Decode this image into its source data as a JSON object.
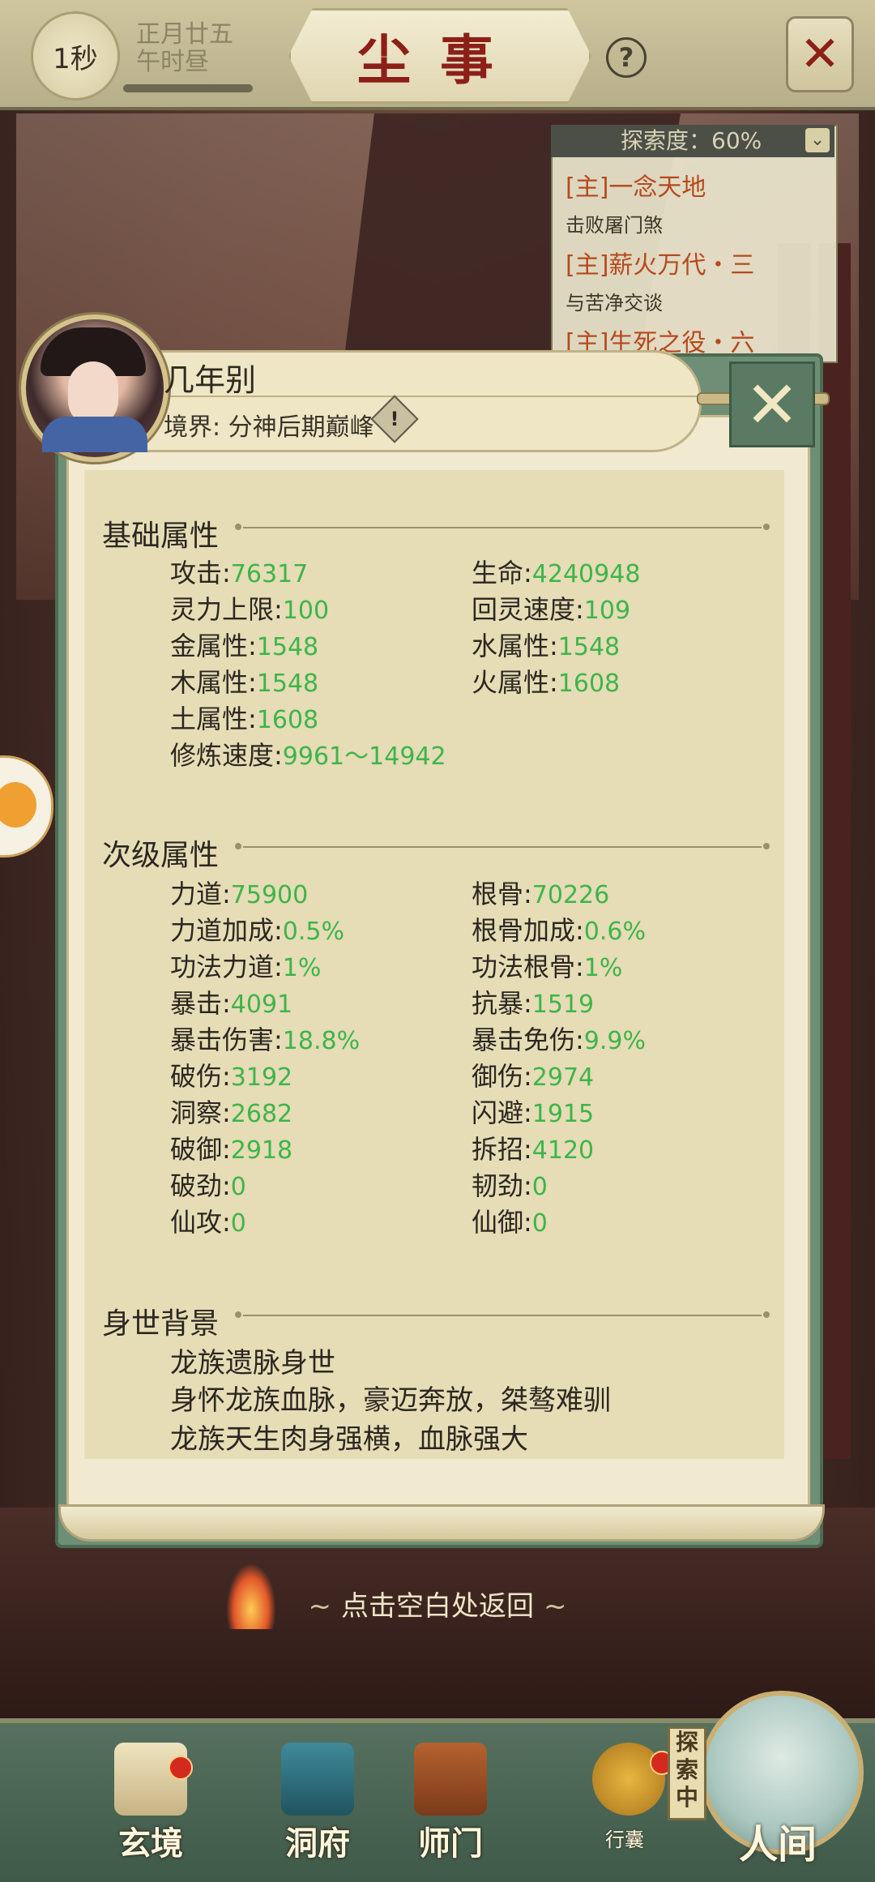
{
  "header": {
    "timer": "1秒",
    "date_line1": "正月廿五",
    "date_line2": "午时昼",
    "title": "尘事"
  },
  "quest_panel": {
    "explore_label": "探索度：60%",
    "quests": [
      {
        "title": "[主]一念天地",
        "desc": "击败屠门煞"
      },
      {
        "title": "[主]薪火万代・三",
        "desc": "与苦净交谈"
      },
      {
        "title": "[主]生死之役・六",
        "desc": ""
      }
    ]
  },
  "character": {
    "name": "几年别",
    "realm": "境界: 分神后期巅峰",
    "realm_icon": "!"
  },
  "sections": {
    "basic_title": "基础属性",
    "secondary_title": "次级属性",
    "background_title": "身世背景"
  },
  "basic_stats": [
    {
      "label": "攻击:",
      "value": "76317"
    },
    {
      "label": "生命:",
      "value": "4240948"
    },
    {
      "label": "灵力上限:",
      "value": "100"
    },
    {
      "label": "回灵速度:",
      "value": "109"
    },
    {
      "label": "金属性:",
      "value": "1548"
    },
    {
      "label": "水属性:",
      "value": "1548"
    },
    {
      "label": "木属性:",
      "value": "1548"
    },
    {
      "label": "火属性:",
      "value": "1608"
    },
    {
      "label": "土属性:",
      "value": "1608"
    },
    {
      "label": "修炼速度:",
      "value": "9961～14942"
    }
  ],
  "secondary_stats": [
    {
      "label": "力道:",
      "value": "75900"
    },
    {
      "label": "根骨:",
      "value": "70226"
    },
    {
      "label": "力道加成:",
      "value": "0.5%"
    },
    {
      "label": "根骨加成:",
      "value": "0.6%"
    },
    {
      "label": "功法力道:",
      "value": "1%"
    },
    {
      "label": "功法根骨:",
      "value": "1%"
    },
    {
      "label": "暴击:",
      "value": "4091"
    },
    {
      "label": "抗暴:",
      "value": "1519"
    },
    {
      "label": "暴击伤害:",
      "value": "18.8%"
    },
    {
      "label": "暴击免伤:",
      "value": "9.9%"
    },
    {
      "label": "破伤:",
      "value": "3192"
    },
    {
      "label": "御伤:",
      "value": "2974"
    },
    {
      "label": "洞察:",
      "value": "2682"
    },
    {
      "label": "闪避:",
      "value": "1915"
    },
    {
      "label": "破御:",
      "value": "2918"
    },
    {
      "label": "拆招:",
      "value": "4120"
    },
    {
      "label": "破劲:",
      "value": "0"
    },
    {
      "label": "韧劲:",
      "value": "0"
    },
    {
      "label": "仙攻:",
      "value": "0"
    },
    {
      "label": "仙御:",
      "value": "0"
    }
  ],
  "background": {
    "line1": "龙族遗脉身世",
    "line2": "身怀龙族血脉，豪迈奔放，桀骜难驯",
    "line3": "龙族天生肉身强横，血脉强大"
  },
  "return_hint": "点击空白处返回",
  "bottom_nav": {
    "items": [
      "玄境",
      "洞府",
      "师门"
    ],
    "bag": "行囊",
    "explore_tag": "探索中",
    "world": "人间"
  },
  "colors": {
    "stat_value": "#3db54a",
    "title_red": "#8c1f18",
    "quest_orange": "#b54a1e"
  }
}
